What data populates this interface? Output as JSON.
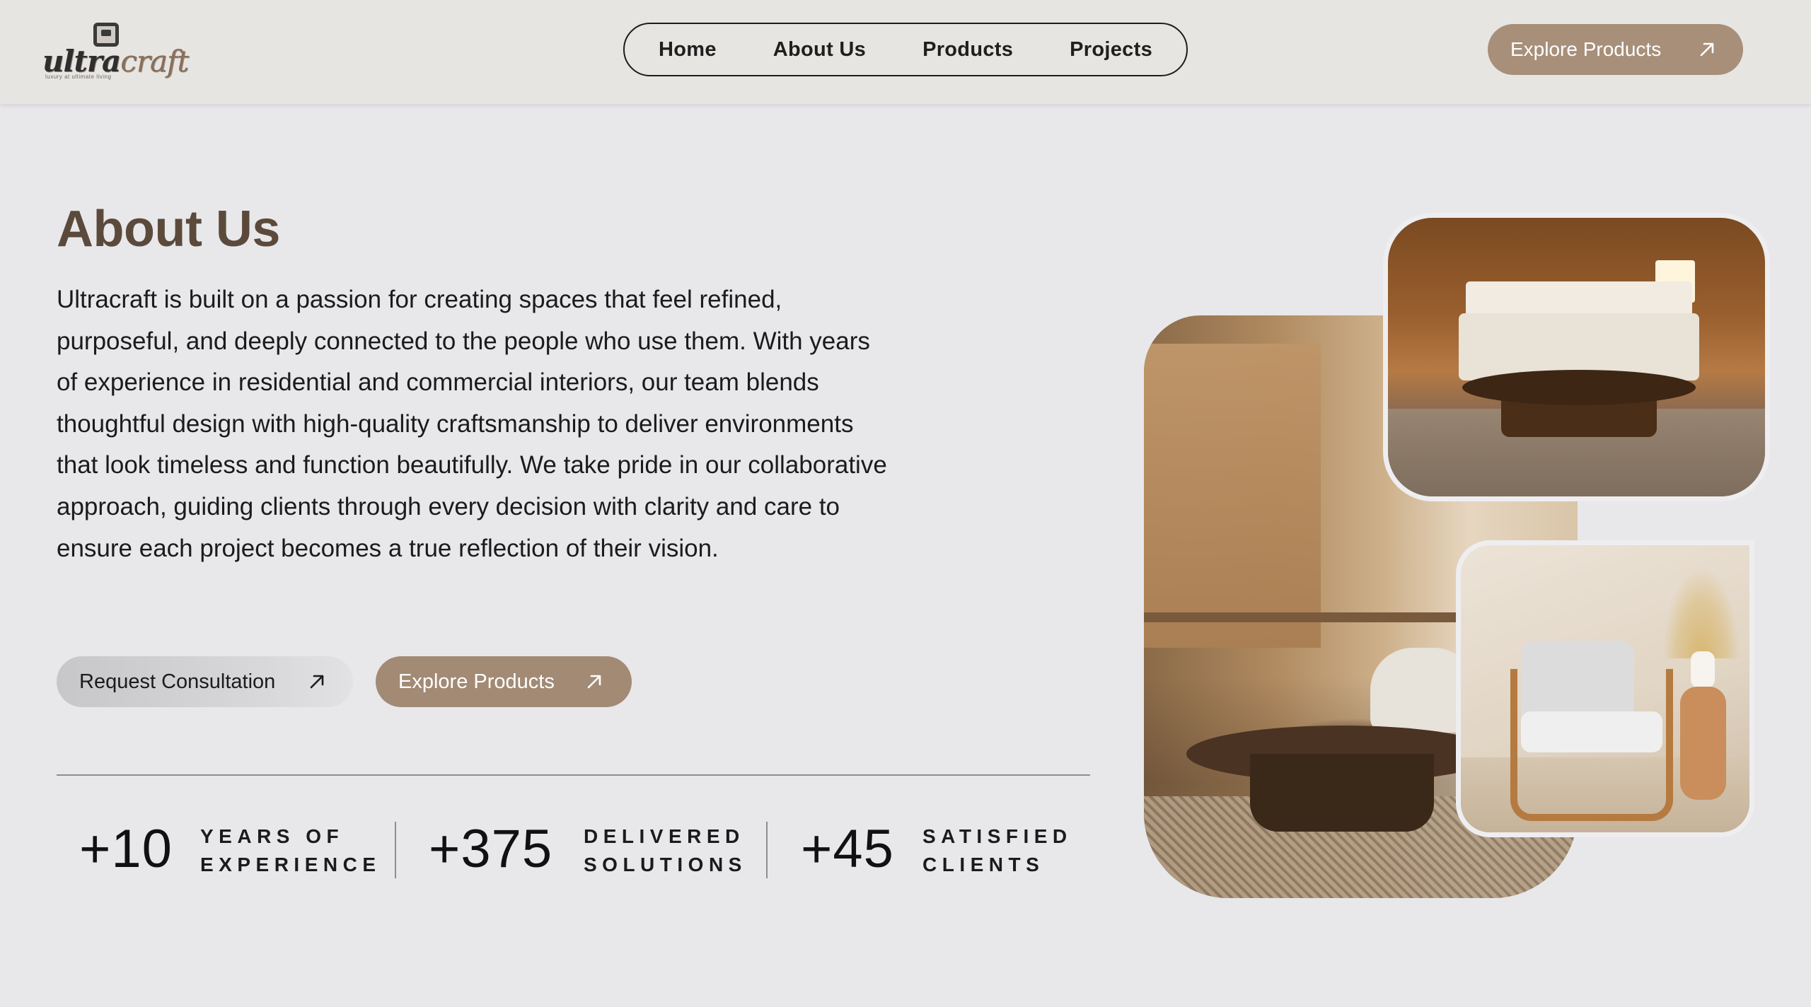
{
  "header": {
    "logo_word_a": "ultra",
    "logo_word_b": "craft",
    "logo_tagline": "luxury at ultimate living",
    "nav": [
      "Home",
      "About Us",
      "Products",
      "Projects"
    ],
    "cta_label": "Explore Products"
  },
  "about": {
    "title": "About Us",
    "body": "Ultracraft is built on a passion for creating spaces that feel refined, purposeful, and deeply connected to the people who use them. With years of experience in residential and commercial interiors, our team blends thoughtful design with high-quality craftsmanship to deliver environments that look timeless and function beautifully. We take pride in our collaborative approach, guiding clients through every decision with clarity and care to ensure each project becomes a true reflection of their vision.",
    "consult_label": "Request Consultation",
    "explore_label": "Explore Products"
  },
  "stats": [
    {
      "value": "+10",
      "label_line1": "YEARS OF",
      "label_line2": "EXPERIENCE"
    },
    {
      "value": "+375",
      "label_line1": "DELIVERED",
      "label_line2": "SOLUTIONS"
    },
    {
      "value": "+45",
      "label_line1": "SATISFIED",
      "label_line2": "CLIENTS"
    }
  ],
  "colors": {
    "accent_brown": "#a78f7a",
    "title_brown": "#5b4a3b",
    "page_bg": "#e8e8eb"
  },
  "icons": {
    "button_arrow": "arrow-up-right-icon"
  }
}
